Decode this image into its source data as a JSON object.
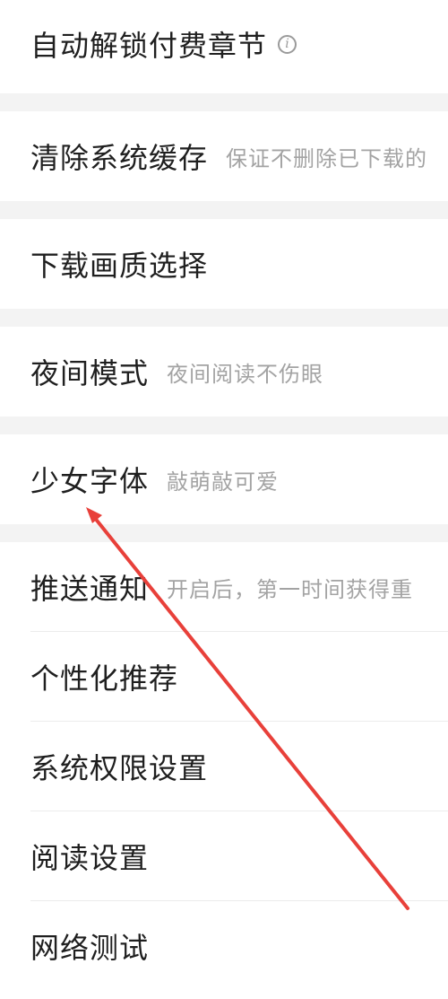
{
  "settings": {
    "items": [
      {
        "label": "自动解锁付费章节",
        "desc": "",
        "icon": "info-icon"
      },
      {
        "label": "清除系统缓存",
        "desc": "保证不删除已下载的"
      },
      {
        "label": "下载画质选择",
        "desc": ""
      },
      {
        "label": "夜间模式",
        "desc": "夜间阅读不伤眼"
      },
      {
        "label": "少女字体",
        "desc": "敲萌敲可爱"
      },
      {
        "label": "推送通知",
        "desc": "开启后，第一时间获得重"
      },
      {
        "label": "个性化推荐",
        "desc": ""
      },
      {
        "label": "系统权限设置",
        "desc": ""
      },
      {
        "label": "阅读设置",
        "desc": ""
      },
      {
        "label": "网络测试",
        "desc": ""
      }
    ]
  },
  "colors": {
    "annotation_arrow": "#e8403a",
    "section_gap": "#f3f3f3",
    "label_text": "#1f1f1f",
    "desc_text": "#a3a3a3"
  }
}
